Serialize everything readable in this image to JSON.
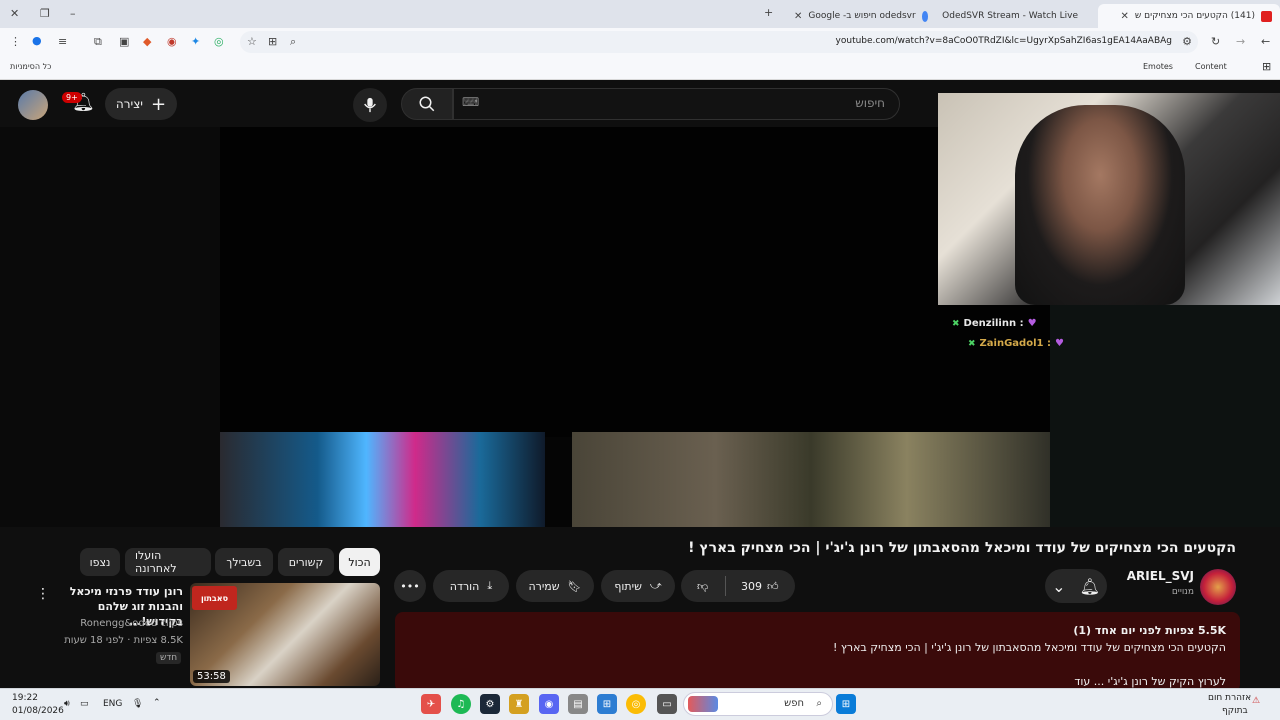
{
  "browser": {
    "tabs": [
      {
        "title": "(141) הקטעים הכי מצחיקים ש",
        "active": true
      },
      {
        "title": "OdedSVR Stream - Watch Live",
        "active": false
      },
      {
        "title": "odedsvr חיפוש ב- Google",
        "active": false
      }
    ],
    "url": "youtube.com/watch?v=8aCoO0TRdZI&lc=UgyrXpSahZI6as1gEA14AaABAg",
    "bookmarks": {
      "all_bookmarks": "כל הסימניות",
      "emotes": "Emotes",
      "content": "Content"
    }
  },
  "header": {
    "search_placeholder": "חיפוש",
    "create_label": "יצירה",
    "notification_count": "9+"
  },
  "chat": [
    {
      "user": "Denzilinn :"
    },
    {
      "user": "ZainGadol1 :"
    }
  ],
  "video": {
    "title": "הקטעים הכי מצחיקים של עודד ומיכאל מהסאבתון של רונן ג'יג'י | הכי מצחיק בארץ !",
    "channel": "ARIEL_SVJ",
    "subscribers": "מנויים",
    "likes": "309",
    "share_label": "שיתוף",
    "save_label": "שמירה",
    "download_label": "הורדה",
    "views": "5.5K צפיות",
    "age": "לפני יום אחד (1)",
    "description_line1": "הקטעים הכי מצחיקים של עודד ומיכאל מהסאבתון של רונן ג'יג'י | הכי מצחיק בארץ !",
    "description_line2": "לערוץ הקיק של רונן ג'יג'י ... עוד"
  },
  "chips": [
    "הכול",
    "קשורים",
    "בשבילך",
    "הועלו לאחרונה",
    "נצפו"
  ],
  "related": {
    "title": "רונן עודד פרנזי מיכאל והבנות זוג שלהם בקידוש!...",
    "channel": "Ronengg&oded clips",
    "meta": "8.5K צפיות · לפני 18 שעות",
    "new_badge": "חדש",
    "duration": "53:58",
    "thumb_badge": "סאבתון"
  },
  "taskbar": {
    "time": "19:22",
    "date": "01/08/2026",
    "lang": "ENG",
    "search_label": "חפש",
    "weather_line1": "אזהרת חום",
    "weather_line2": "בתוקף"
  }
}
